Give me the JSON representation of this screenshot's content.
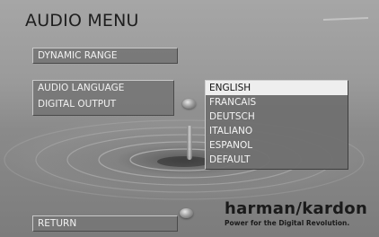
{
  "header": {
    "title": "AUDIO MENU"
  },
  "menu": {
    "dynamic_range": "DYNAMIC RANGE",
    "audio_language": "AUDIO LANGUAGE",
    "digital_output": "DIGITAL OUTPUT",
    "return": "RETURN"
  },
  "language_list": {
    "options": [
      "ENGLISH",
      "FRANCAIS",
      "DEUTSCH",
      "ITALIANO",
      "ESPANOL",
      "DEFAULT"
    ],
    "selected": "ENGLISH"
  },
  "brand": {
    "name": "harman/kardon",
    "tagline": "Power for the Digital Revolution."
  },
  "icons": [
    "orb-icon",
    "water-drop-icon"
  ],
  "colors": {
    "panel": "#767676",
    "selected_bg": "#eeeeee",
    "text": "#f2f2f2"
  }
}
